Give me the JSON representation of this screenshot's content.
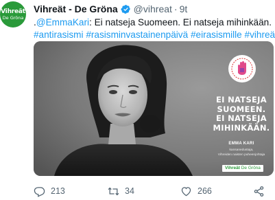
{
  "tweet": {
    "avatar": {
      "line1": "Vihreät",
      "line2": "De Gröna"
    },
    "display_name": "Vihreät - De Gröna",
    "handle": "@vihreat",
    "separator": "·",
    "time": "9t",
    "verified_icon": "verified-badge-icon",
    "text_line1": {
      "prefix": ".",
      "mention": "@EmmaKari",
      "rest": ": Ei natseja Suomeen. Ei natseja mihinkään."
    },
    "hashtags": [
      "#antirasismi",
      "#rasisminvastainenpäivä",
      "#eirasismille",
      "#vihreät"
    ],
    "hashtag_separator": " "
  },
  "poster": {
    "heading_lines": [
      "EI NATSEJA",
      "SUOMEEN.",
      "EI NATSEJA",
      "MIHINKÄÄN."
    ],
    "name": "EMMA KARI",
    "role_lines": [
      "kansanedustaja,",
      "Vihreiden naisten puheenjohtaja"
    ],
    "logo_bold": "Vihreät",
    "logo_light": "De Gröna",
    "badge_icon": "antiracism-hand-badge-icon"
  },
  "actions": {
    "reply": {
      "icon": "reply-icon",
      "count": "213"
    },
    "retweet": {
      "icon": "retweet-icon",
      "count": "34"
    },
    "like": {
      "icon": "heart-icon",
      "count": "266"
    },
    "share": {
      "icon": "share-icon"
    }
  },
  "colors": {
    "link": "#1d9bf0",
    "brand_green": "#2a9a3a",
    "meta_gray": "#536471"
  }
}
